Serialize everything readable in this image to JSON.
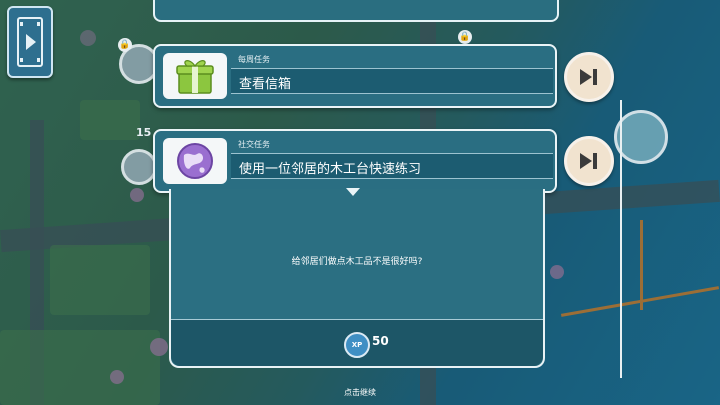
{
  "tasks": [
    {
      "category": "每周任务",
      "title": "查看信箱",
      "icon": "gift-box-icon"
    },
    {
      "category": "社交任务",
      "title": "使用一位邻居的木工台快速练习",
      "icon": "globe-icon"
    }
  ],
  "dialog": {
    "description": "给邻居们做点木工品不是很好吗?",
    "reward": {
      "badge": "XP",
      "value": "50"
    }
  },
  "continue_text": "点击继续",
  "map": {
    "level_label": "15"
  },
  "colors": {
    "panel": "#2a6e82",
    "panel_border": "#eaf4f7",
    "skip_button": "#f1e3cf",
    "xp_badge": "#3f8fc4"
  }
}
